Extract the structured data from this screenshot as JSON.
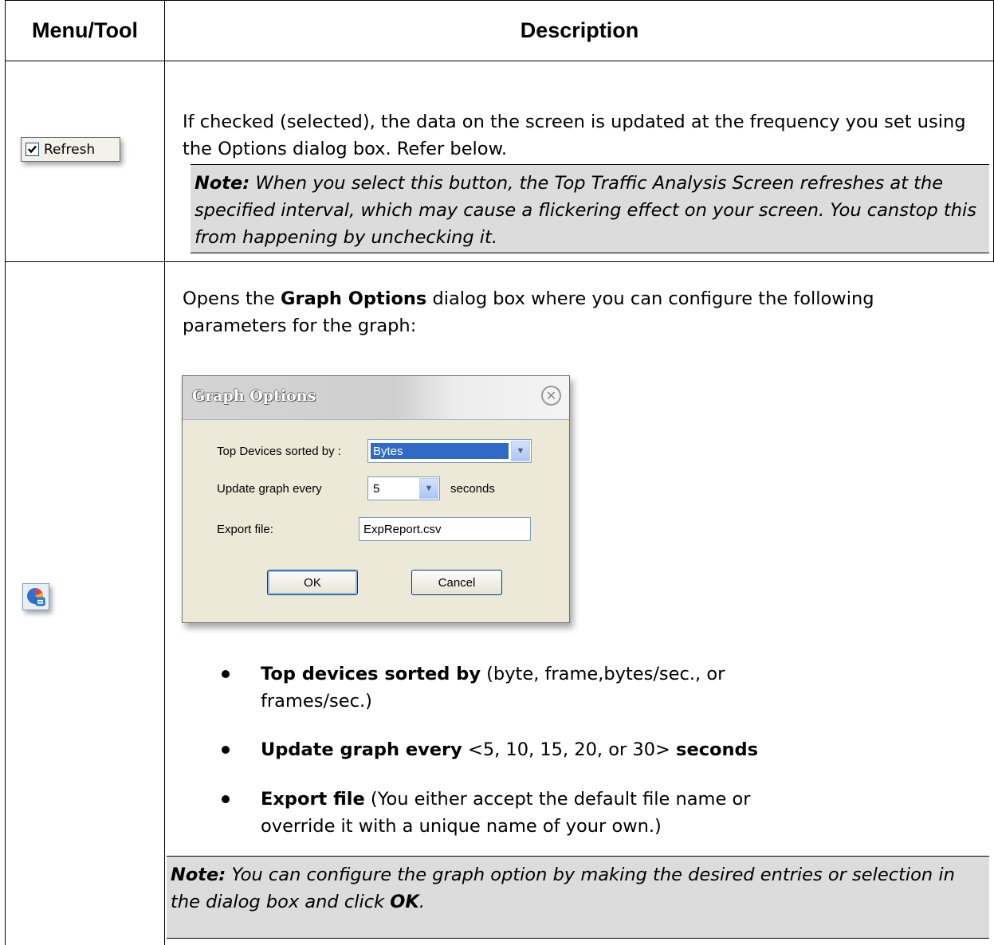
{
  "table": {
    "header": {
      "col1": "Menu/Tool",
      "col2": "Description"
    }
  },
  "row_refresh": {
    "tool_label": "Refresh",
    "tool_icon": "checked-checkbox-icon",
    "description": "If checked (selected), the data on the screen is updated at the frequency you set using the Options dialog box. Refer below.",
    "note_label": "Note:",
    "note_text": " When you select this button, the Top Traffic Analysis Screen refreshes at the specified interval, which may cause a flickering effect on your screen. You canstop this from happening by unchecking it."
  },
  "row_graph": {
    "tool_icon": "graph-options-icon",
    "intro_before": "Opens the ",
    "intro_bold": "Graph Options",
    "intro_after": " dialog box where you can configure the following parameters for the graph:",
    "dialog": {
      "title": "Graph Options",
      "close_icon": "close-icon",
      "sorted_label": "Top Devices sorted by :",
      "sorted_value": "Bytes",
      "update_label": "Update graph every",
      "update_value": "5",
      "update_unit": "seconds",
      "export_label": "Export file:",
      "export_value": "ExpReport.csv",
      "ok_label": "OK",
      "cancel_label": "Cancel"
    },
    "bullets": [
      {
        "bold": "Top devices sorted by",
        "text": " (byte, frame,bytes/sec., or frames/sec.)"
      },
      {
        "bold": "Update graph every",
        "text": " <5, 10, 15, 20, or 30> ",
        "bold2": "seconds"
      },
      {
        "bold": "Export file",
        "text": " (You either accept the default file name or override it with a unique name of your own.)"
      }
    ],
    "note_label": "Note:",
    "note_text": " You can configure the graph option by making the desired entries or selection in the dialog box and click ",
    "note_ok": "OK",
    "note_end": "."
  }
}
